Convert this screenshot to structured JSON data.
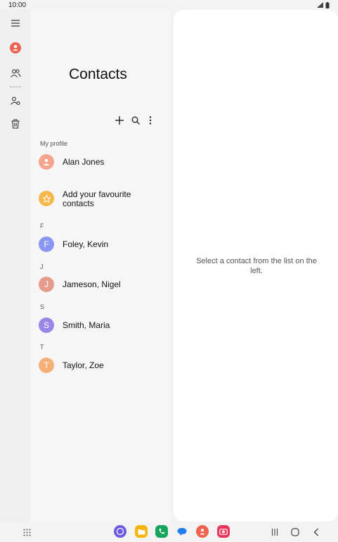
{
  "status": {
    "time": "10:00",
    "icons": [
      "signal-icon",
      "battery-icon"
    ]
  },
  "rail": {
    "items": [
      "menu-icon",
      "contacts-icon",
      "groups-icon",
      "manage-contacts-icon",
      "trash-icon"
    ]
  },
  "header": {
    "title": "Contacts"
  },
  "toolbar": {
    "icons": [
      "add-icon",
      "search-icon",
      "more-options-icon"
    ]
  },
  "profile": {
    "section_label": "My profile",
    "name": "Alan Jones"
  },
  "favourites": {
    "line1": "Add your favourite",
    "line2": "contacts"
  },
  "contacts": [
    {
      "section": "F",
      "initial": "F",
      "name": "Foley, Kevin",
      "color": "#8a97f2"
    },
    {
      "section": "J",
      "initial": "J",
      "name": "Jameson, Nigel",
      "color": "#e69a8b"
    },
    {
      "section": "S",
      "initial": "S",
      "name": "Smith, Maria",
      "color": "#9a86e6"
    },
    {
      "section": "T",
      "initial": "T",
      "name": "Taylor, Zoe",
      "color": "#f5b077"
    }
  ],
  "detail": {
    "message": "Select a contact from the list on the left."
  },
  "dock": {
    "apps": [
      "internet-app-icon",
      "my-files-app-icon",
      "phone-app-icon",
      "messages-app-icon",
      "contacts-app-icon",
      "camera-app-icon"
    ]
  },
  "nav": {
    "buttons": [
      "app-drawer-icon",
      "recents-icon",
      "home-icon",
      "back-icon"
    ]
  }
}
